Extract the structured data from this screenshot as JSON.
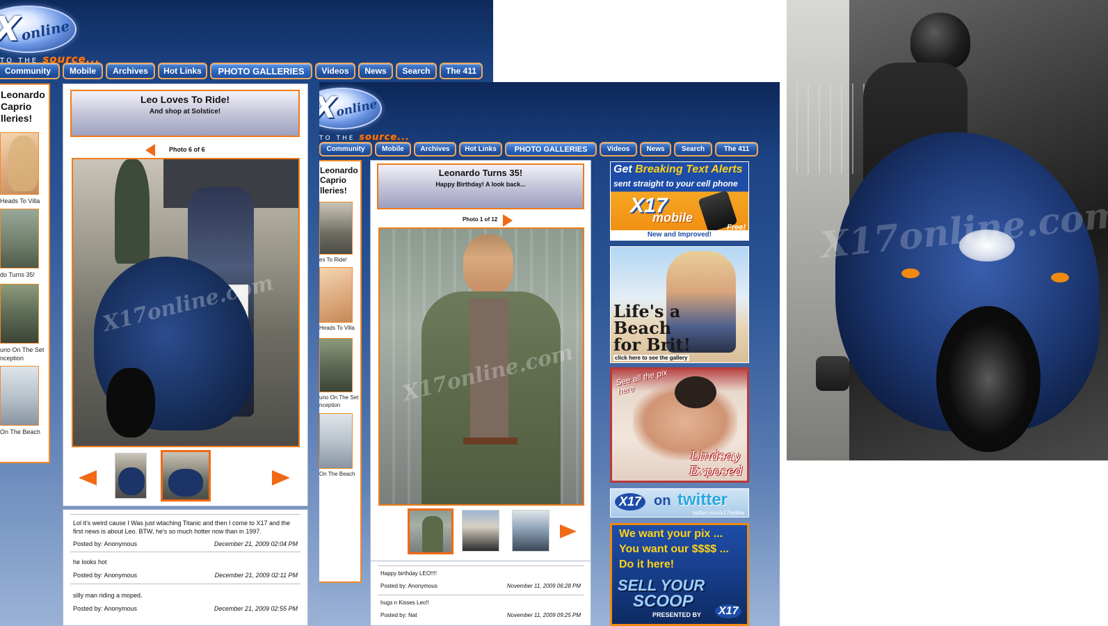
{
  "back": {
    "logo": {
      "x": "X",
      "online": "online",
      "tag_prefix": "TO THE",
      "tag_word": "source..."
    },
    "nav": [
      "Community",
      "Mobile",
      "Archives",
      "Hot Links",
      "PHOTO GALLERIES",
      "Videos",
      "News",
      "Search",
      "The 411"
    ],
    "sidebar": {
      "title": "Leonardo\nCaprio\nlleries!",
      "captions": [
        "Heads To Villa",
        "do Turns 35!",
        "uno On The Set",
        "nception",
        "On The Beach"
      ]
    },
    "gallery": {
      "title": "Leo Loves To Ride!",
      "subtitle": "And shop at Solstice!",
      "photo_count": "Photo 6 of 6",
      "watermark": "X17online.com"
    },
    "comments": [
      {
        "text": "Lol it's weird cause I Was just wtaching Titanic and then I come to X17 and the first news is about Leo. BTW, he's so much hotter now than in 1997.",
        "by": "Posted by: Anonymous",
        "date": "December 21, 2009 02:04 PM"
      },
      {
        "text": "he looks hot",
        "by": "Posted by: Anonymous",
        "date": "December 21, 2009 02:11 PM"
      },
      {
        "text": "silly man riding a moped.",
        "by": "Posted by: Anonymous",
        "date": "December 21, 2009 02:55 PM"
      }
    ]
  },
  "front": {
    "logo": {
      "x": "X",
      "online": "online",
      "tag_prefix": "TO THE",
      "tag_word": "source..."
    },
    "nav": [
      "Community",
      "Mobile",
      "Archives",
      "Hot Links",
      "PHOTO GALLERIES",
      "Videos",
      "News",
      "Search",
      "The 411"
    ],
    "sidebar": {
      "title": "Leonardo\nCaprio\nlleries!",
      "captions": [
        "es To Ride!",
        "Heads To Villa",
        "uno On The Set",
        "nception",
        "On The Beach"
      ]
    },
    "gallery": {
      "title": "Leonardo Turns 35!",
      "subtitle": "Happy Birthday! A look back...",
      "photo_count": "Photo 1 of 12",
      "watermark": "X17online.com"
    },
    "comments": [
      {
        "text": "Happy birthday LEO!!!!",
        "by": "Posted by: Anonymous",
        "date": "November 11, 2009 06:28 PM"
      },
      {
        "text": "hugs n Kisses Leo!!",
        "by": "Posted by: Nat",
        "date": "November 11, 2009 09:25 PM"
      }
    ],
    "ads": {
      "text_alerts": {
        "line1a": "Get ",
        "line1b": "Breaking Text Alerts",
        "line2": "sent straight to your cell phone",
        "brand": "X17",
        "brand2": "mobile",
        "free": "Free!",
        "footer": "New and Improved!"
      },
      "brit": {
        "line1": "Life's a",
        "line2": "Beach",
        "line3": "for Brit!",
        "footer": "click here to see the gallery"
      },
      "lindsay": {
        "corner": "See all the pix here",
        "name1": "Lindsay",
        "name2": "Exposed"
      },
      "twitter": {
        "brand": "X17",
        "on": "on",
        "twitter": "twitter",
        "url": "twitter.com/x17online"
      },
      "scoop": {
        "line1": "We want your pix ...",
        "line2": "You want our $$$$ ...",
        "line3": "Do it here!",
        "sell": "SELL YOUR",
        "scoop": "SCOOP",
        "presented": "PRESENTED BY",
        "brand": "X17"
      }
    }
  },
  "right_photo": {
    "watermark": "X17online.com"
  },
  "colors": {
    "accent": "#f06a16",
    "nav_blue": "#2759aa",
    "page_blue": "#1d4585"
  }
}
